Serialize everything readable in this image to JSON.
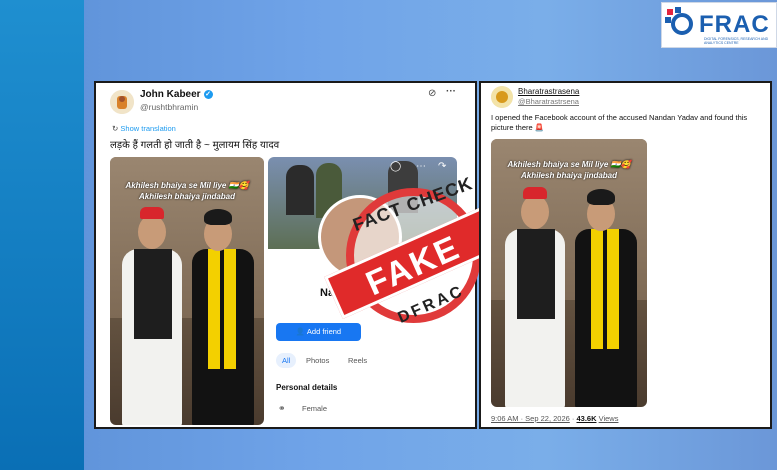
{
  "logo": {
    "text": "FRAC",
    "tagline": "DIGITAL FORENSICS, RESEARCH AND ANALYTICS CENTRE"
  },
  "left_tweet": {
    "author_name": "John Kabeer",
    "author_handle": "@rushtbhramin",
    "show_translation": "Show translation",
    "text": "लड़के हैं गलती हो जाती है ~ मुलायम सिंह यादव",
    "photo_caption_line1": "Akhilesh bhaiya se Mil liye 🇮🇳🥰",
    "photo_caption_line2": "Akhilesh bhaiya jindabad",
    "fb_profile_name": "Nand",
    "fb_add_friend": "Add friend",
    "fb_tabs": [
      "All",
      "Photos",
      "Reels"
    ],
    "fb_personal_details": "Personal details",
    "fb_gender": "Female"
  },
  "stamp": {
    "top": "FACT CHECK",
    "main": "FAKE",
    "bottom": "DFRAC"
  },
  "right_tweet": {
    "author_name": "Bharatrastrasena",
    "author_handle": "@Bharatrastrsena",
    "text": "I opened the Facebook account of the accused Nandan Yadav and found this picture there 🚨",
    "photo_caption_line1": "Akhilesh bhaiya se Mil liye 🇮🇳🥰",
    "photo_caption_line2": "Akhilesh bhaiya jindabad",
    "time": "9:06 AM · Sep 22, 2026",
    "views_count": "43.6K",
    "views_label": "Views"
  },
  "colors": {
    "fake_red": "#e02a2a",
    "twitter_blue": "#1d9bf0",
    "facebook_blue": "#1877f2"
  }
}
